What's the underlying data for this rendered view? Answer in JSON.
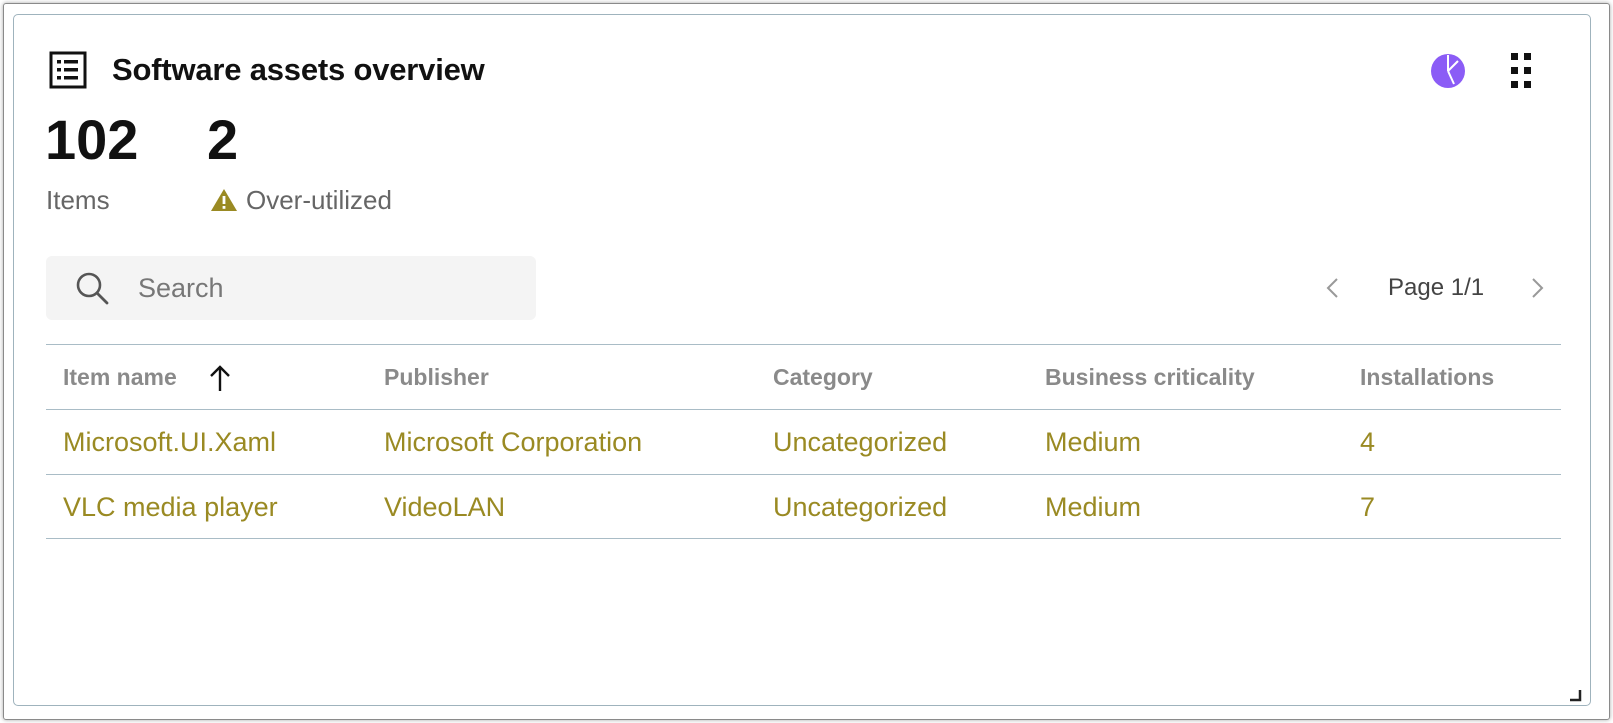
{
  "card": {
    "title": "Software assets overview",
    "icon": "list-icon"
  },
  "header_actions": {
    "chart_icon": "pie-chart-icon",
    "menu_icon": "drag-handle-icon",
    "accent_color": "#8b5cf6"
  },
  "stats": [
    {
      "value": "102",
      "label": "Items"
    },
    {
      "value": "2",
      "label": "Over-utilized",
      "icon": "warning-icon",
      "icon_color": "#9a8a23"
    }
  ],
  "search": {
    "placeholder": "Search",
    "value": ""
  },
  "pagination": {
    "label": "Page 1/1"
  },
  "table": {
    "columns": [
      "Item name",
      "Publisher",
      "Category",
      "Business criticality",
      "Installations"
    ],
    "sort": {
      "column": "Item name",
      "direction": "ascending"
    },
    "rows": [
      [
        "Microsoft.UI.Xaml",
        "Microsoft Corporation",
        "Uncategorized",
        "Medium",
        "4"
      ],
      [
        "VLC media player",
        "VideoLAN",
        "Uncategorized",
        "Medium",
        "7"
      ]
    ],
    "link_color": "#9a8a23"
  }
}
